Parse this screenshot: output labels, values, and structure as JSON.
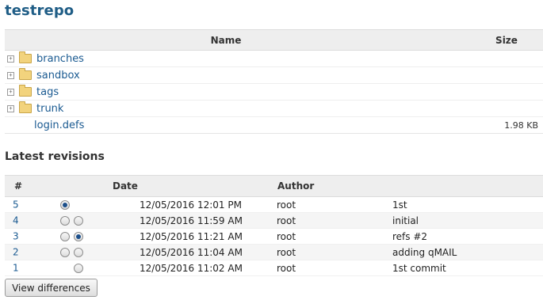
{
  "repo_title": "testrepo",
  "files": {
    "headers": {
      "name": "Name",
      "size": "Size"
    },
    "rows": [
      {
        "name": "branches",
        "size": "",
        "type": "folder"
      },
      {
        "name": "sandbox",
        "size": "",
        "type": "folder"
      },
      {
        "name": "tags",
        "size": "",
        "type": "folder"
      },
      {
        "name": "trunk",
        "size": "",
        "type": "folder"
      },
      {
        "name": "login.defs",
        "size": "1.98 KB",
        "type": "file"
      }
    ]
  },
  "revisions": {
    "section_title": "Latest revisions",
    "headers": {
      "num": "#",
      "date": "Date",
      "author": "Author",
      "message": ""
    },
    "rows": [
      {
        "num": "5",
        "date": "12/05/2016 12:01 PM",
        "author": "root",
        "message": "1st",
        "radio1": "on",
        "radio2": "none"
      },
      {
        "num": "4",
        "date": "12/05/2016 11:59 AM",
        "author": "root",
        "message": "initial",
        "radio1": "off",
        "radio2": "off"
      },
      {
        "num": "3",
        "date": "12/05/2016 11:21 AM",
        "author": "root",
        "message": "refs #2",
        "radio1": "off",
        "radio2": "on"
      },
      {
        "num": "2",
        "date": "12/05/2016 11:04 AM",
        "author": "root",
        "message": "adding qMAIL",
        "radio1": "off",
        "radio2": "off"
      },
      {
        "num": "1",
        "date": "12/05/2016 11:02 AM",
        "author": "root",
        "message": "1st commit",
        "radio1": "none",
        "radio2": "off"
      }
    ]
  },
  "view_differences_label": "View differences",
  "colors": {
    "link": "#1a5a91",
    "title": "#1f5d86",
    "header_bg": "#eeeeee"
  }
}
